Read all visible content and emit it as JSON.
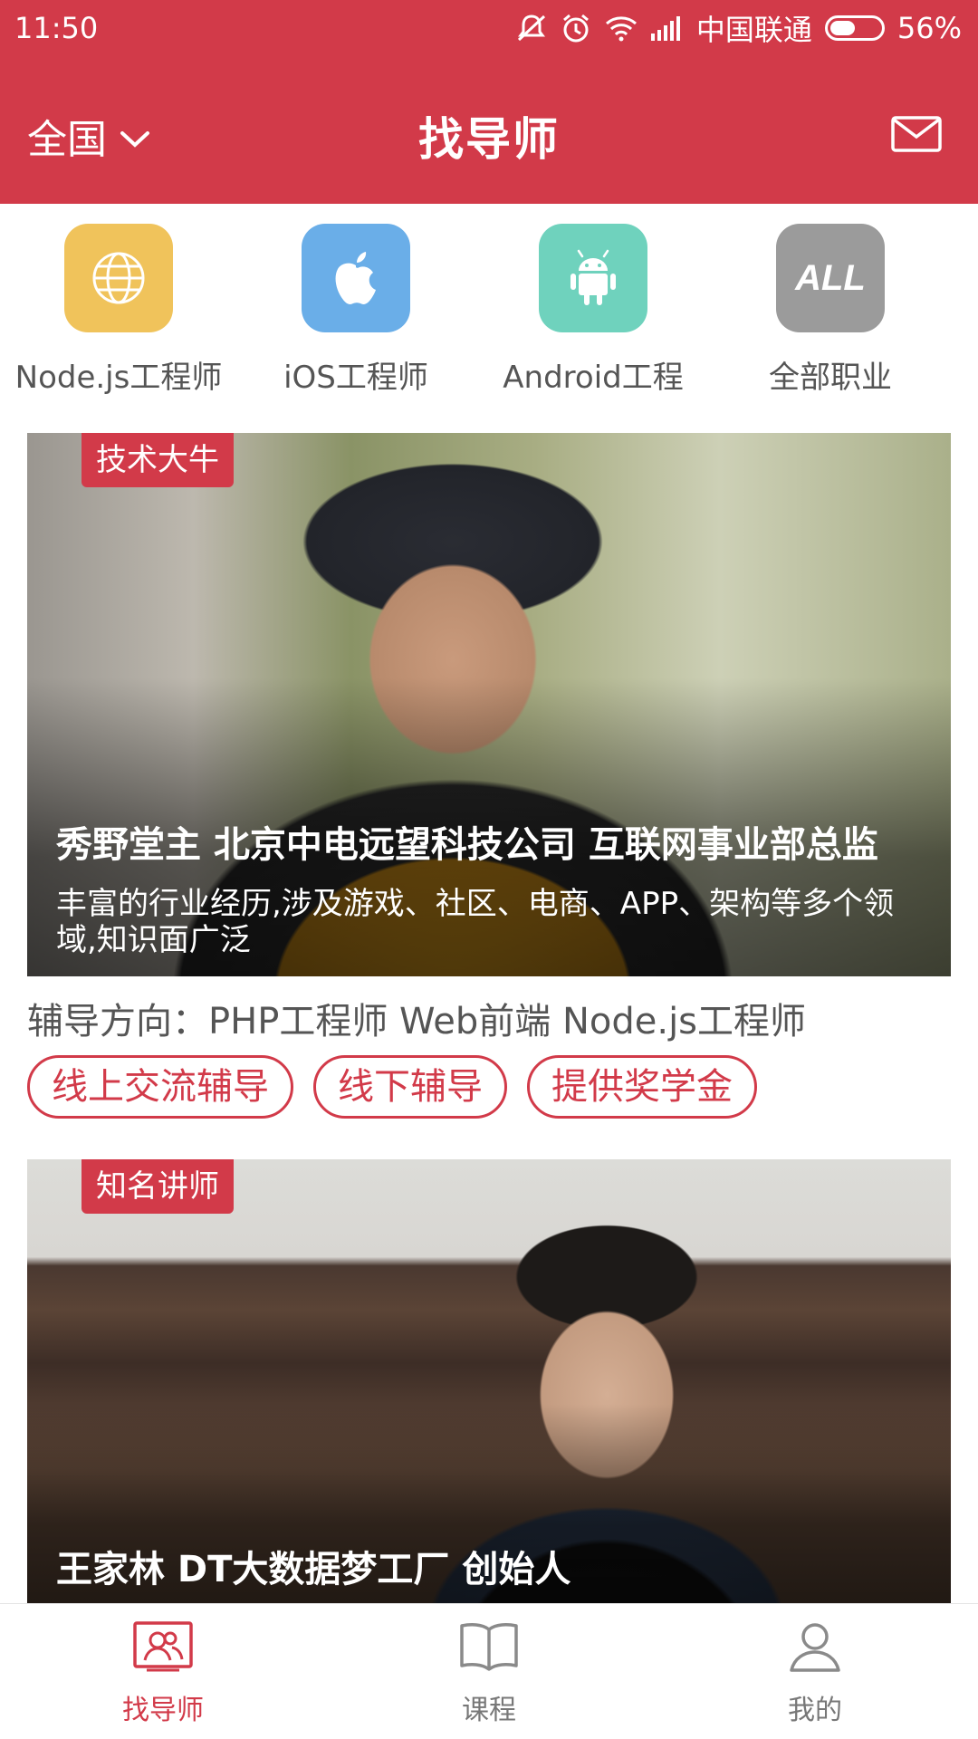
{
  "status_bar": {
    "time": "11:50",
    "carrier": "中国联通",
    "battery_percent": "56%",
    "battery_level": 0.56,
    "icons": [
      "mute-icon",
      "alarm-icon",
      "wifi-icon",
      "signal-icon",
      "battery-icon"
    ]
  },
  "header": {
    "region": "全国",
    "title": "找导师",
    "mail_icon": "mail-icon"
  },
  "categories": [
    {
      "label": "Node.js工程师",
      "icon": "globe-icon",
      "color": "#f0c35b"
    },
    {
      "label": "iOS工程师",
      "icon": "apple-icon",
      "color": "#6aaee8"
    },
    {
      "label": "Android工程",
      "icon": "android-icon",
      "color": "#6fd2bd"
    },
    {
      "label": "全部职业",
      "icon": "all-icon",
      "icon_text": "ALL",
      "color": "#9b9b9b"
    }
  ],
  "cards": [
    {
      "tag": "技术大牛",
      "title": "秀野堂主 北京中电远望科技公司 互联网事业部总监",
      "description": "丰富的行业经历,涉及游戏、社区、电商、APP、架构等多个领域,知识面广泛",
      "direction": "辅导方向：PHP工程师 Web前端 Node.js工程师",
      "pills": [
        "线上交流辅导",
        "线下辅导",
        "提供奖学金"
      ]
    },
    {
      "tag": "知名讲师",
      "title": "王家林 DT大数据梦工厂 创始人"
    }
  ],
  "tabs": [
    {
      "label": "找导师",
      "icon": "mentor-icon",
      "active": true
    },
    {
      "label": "课程",
      "icon": "book-icon",
      "active": false
    },
    {
      "label": "我的",
      "icon": "user-icon",
      "active": false
    }
  ],
  "colors": {
    "accent": "#d23a49",
    "text_gray": "#555555"
  }
}
